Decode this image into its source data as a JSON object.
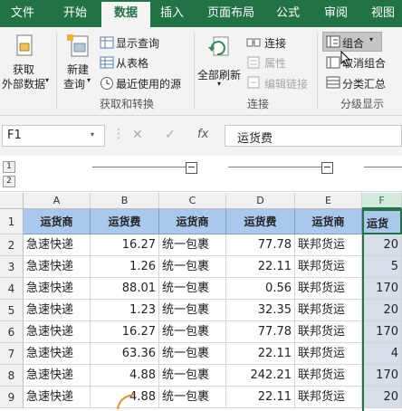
{
  "ribbon_tabs": [
    "文件",
    "开始",
    "数据",
    "插入",
    "页面布局",
    "公式",
    "审阅",
    "视图"
  ],
  "groups": {
    "get_transform": {
      "label": "获取和转换",
      "get_external_line1": "获取",
      "get_external_line2": "外部数据",
      "new_query_line1": "新建",
      "new_query_line2": "查询",
      "show_queries": "显示查询",
      "from_table": "从表格",
      "recent_sources": "最近使用的源"
    },
    "connections": {
      "label": "连接",
      "refresh_all": "全部刷新",
      "connections": "连接",
      "properties": "属性",
      "edit_links": "编辑链接"
    },
    "outline": {
      "label": "分级显示",
      "group": "组合",
      "ungroup": "取消组合",
      "subtotal": "分类汇总"
    }
  },
  "formula_bar": {
    "name_box": "F1",
    "cancel": "✕",
    "enter": "✓",
    "fx": "fx",
    "content": "运货费"
  },
  "outline_levels": [
    "1",
    "2"
  ],
  "outline_collapse": "−",
  "columns": [
    "A",
    "B",
    "C",
    "D",
    "E",
    "F"
  ],
  "rows": [
    "1",
    "2",
    "3",
    "4",
    "5",
    "6",
    "7",
    "8",
    "9"
  ],
  "table": [
    [
      "运货商",
      "运货费",
      "运货商",
      "运货费",
      "运货商",
      "运货"
    ],
    [
      "急速快递",
      "16.27",
      "统一包裹",
      "77.78",
      "联邦货运",
      "20"
    ],
    [
      "急速快递",
      "1.26",
      "统一包裹",
      "22.11",
      "联邦货运",
      "5"
    ],
    [
      "急速快递",
      "88.01",
      "统一包裹",
      "0.56",
      "联邦货运",
      "170"
    ],
    [
      "急速快递",
      "1.23",
      "统一包裹",
      "32.35",
      "联邦货运",
      "20"
    ],
    [
      "急速快递",
      "16.27",
      "统一包裹",
      "77.78",
      "联邦货运",
      "170"
    ],
    [
      "急速快递",
      "63.36",
      "统一包裹",
      "22.11",
      "联邦货运",
      "4"
    ],
    [
      "急速快递",
      "4.88",
      "统一包裹",
      "242.21",
      "联邦货运",
      "170"
    ],
    [
      "急速快递",
      "4.88",
      "统一包裹",
      "22.11",
      "联邦货运",
      "20"
    ]
  ],
  "colors": {
    "accent": "#217346",
    "header_fill": "#a9c8ec"
  }
}
